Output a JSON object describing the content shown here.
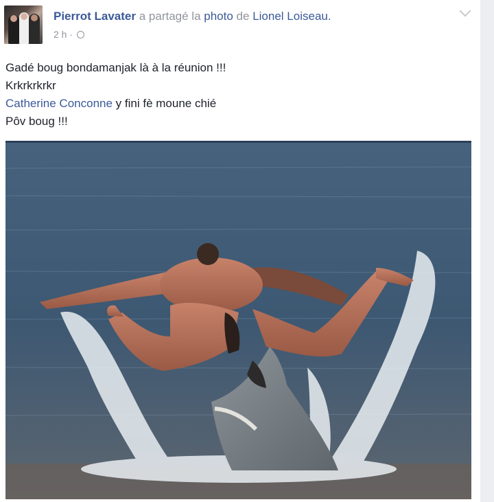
{
  "post": {
    "author": "Pierrot Lavater",
    "action_text": "a partagé la",
    "photo_word": "photo",
    "of_word": "de",
    "original_author": "Lionel Loiseau.",
    "time": "2 h ·",
    "privacy_icon": "globe-icon",
    "lines": {
      "line1": "Gadé boug bondamanjak là à la réunion !!!",
      "line2": "Krkrkrkrkr",
      "mention": "Catherine Conconne",
      "line3_rest": " y fini fè moune chié",
      "line4": "Pôv boug !!!"
    }
  },
  "colors": {
    "link": "#3b5998",
    "meta": "#90949c",
    "text": "#1d2129",
    "sea": "#3f5a73"
  }
}
